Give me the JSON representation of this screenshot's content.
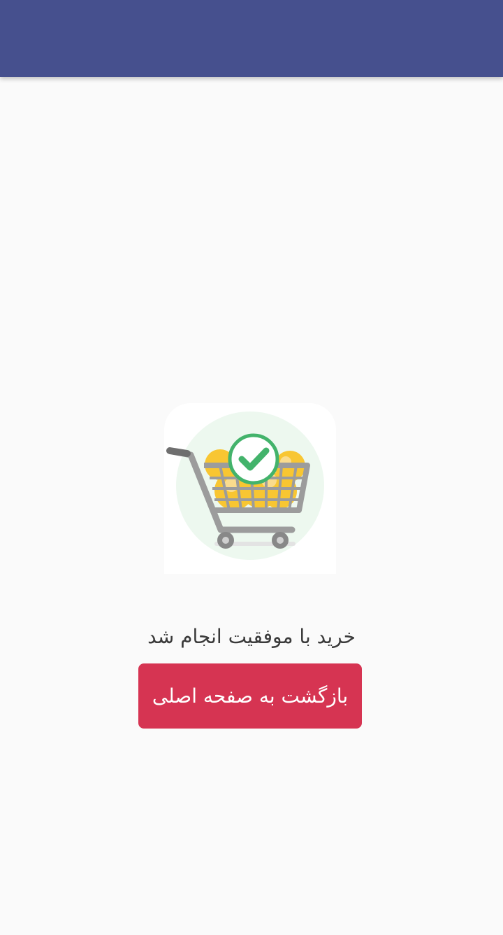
{
  "app_bar": {
    "color": "#46508e"
  },
  "success": {
    "illustration_icon": "shopping-cart-success-icon",
    "message": "خرید با موفقیت انجام شد"
  },
  "actions": {
    "back_home_label": "بازگشت به صفحه اصلی",
    "button_color": "#d63452"
  }
}
